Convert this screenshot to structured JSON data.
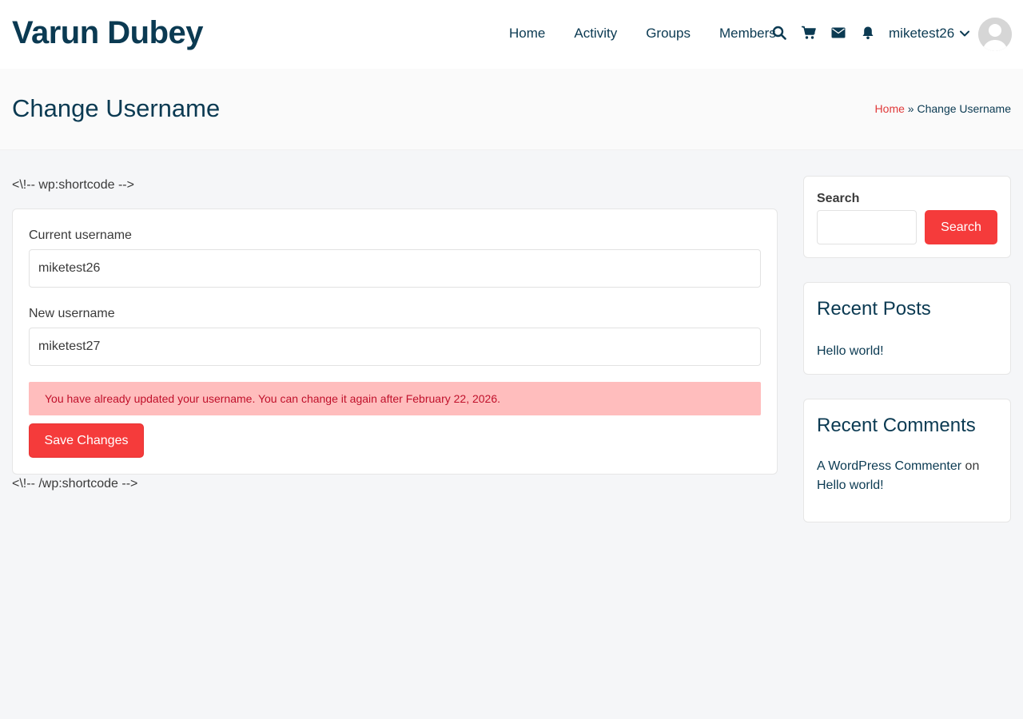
{
  "site": {
    "title": "Varun Dubey"
  },
  "nav": {
    "items": [
      {
        "label": "Home"
      },
      {
        "label": "Activity"
      },
      {
        "label": "Groups"
      },
      {
        "label": "Members"
      }
    ]
  },
  "header_icons": [
    "search-icon",
    "cart-icon",
    "mail-icon",
    "bell-icon"
  ],
  "user": {
    "name": "miketest26"
  },
  "page": {
    "title": "Change Username",
    "breadcrumb": {
      "home": "Home",
      "separator": "»",
      "current": "Change Username"
    }
  },
  "content": {
    "shortcode_open": "<\\!-- wp:shortcode -->",
    "shortcode_close": "<\\!-- /wp:shortcode -->",
    "form": {
      "current_label": "Current username",
      "current_value": "miketest26",
      "new_label": "New username",
      "new_value": "miketest27",
      "alert": "You have already updated your username. You can change it again after February 22, 2026.",
      "save_label": "Save Changes"
    }
  },
  "sidebar": {
    "search": {
      "label": "Search",
      "button": "Search",
      "value": ""
    },
    "recent_posts": {
      "title": "Recent Posts",
      "items": [
        "Hello world!"
      ]
    },
    "recent_comments": {
      "title": "Recent Comments",
      "author": "A WordPress Commenter",
      "connector": "on",
      "post": "Hello world!"
    }
  },
  "colors": {
    "brand_dark": "#0b3a52",
    "accent_red": "#f53b3b",
    "alert_bg": "#ffbdbd",
    "alert_text": "#c0102a",
    "page_bg": "#f5f6f8"
  }
}
